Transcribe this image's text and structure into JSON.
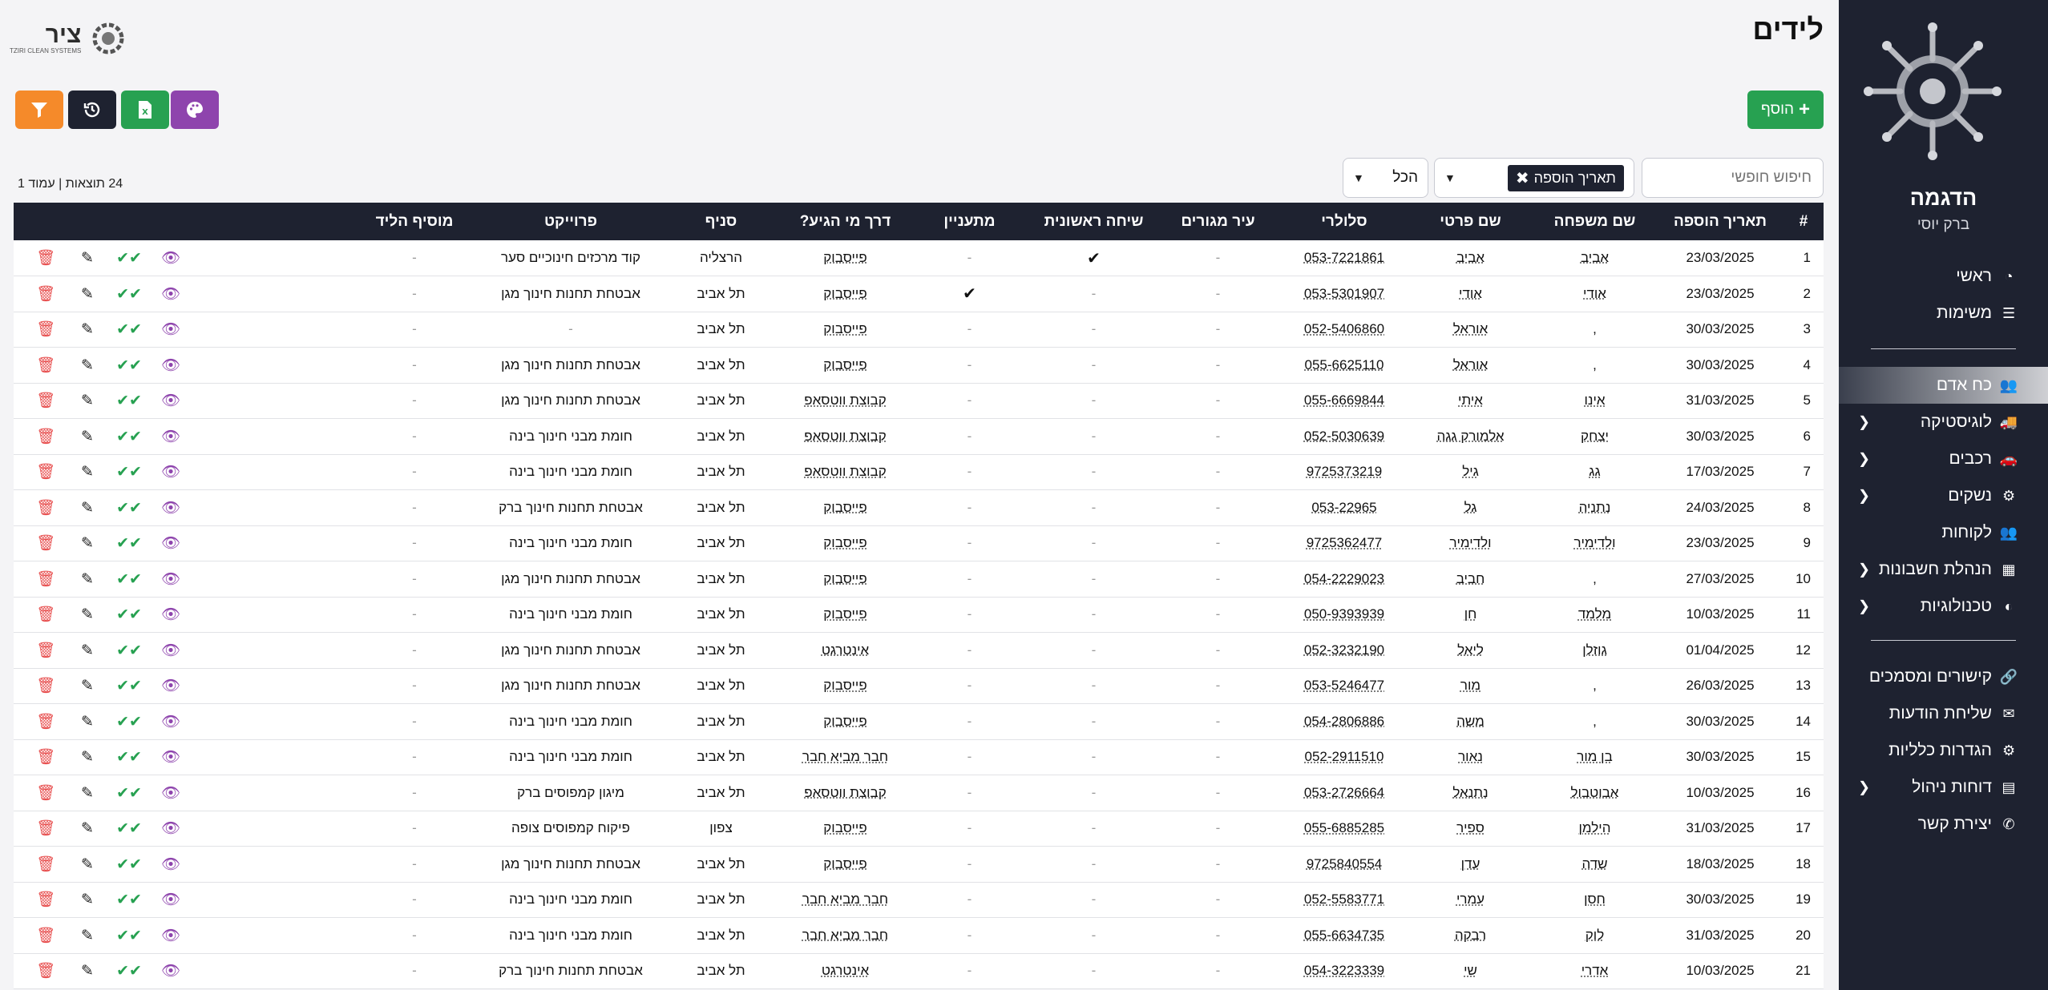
{
  "sidebar": {
    "company": "הדגמה",
    "user": "ברק יוסי",
    "nav_top": [
      {
        "label": "ראשי",
        "icon": "gauge-icon",
        "glyph": "◔"
      },
      {
        "label": "משימות",
        "icon": "tasks-icon",
        "glyph": "☰"
      }
    ],
    "nav_mid": [
      {
        "label": "כח אדם",
        "icon": "users-icon",
        "glyph": "👥",
        "active": true,
        "chevron": false
      },
      {
        "label": "לוגיסטיקה",
        "icon": "truck-icon",
        "glyph": "🚚",
        "chevron": true
      },
      {
        "label": "רכבים",
        "icon": "car-icon",
        "glyph": "🚗",
        "chevron": true
      },
      {
        "label": "נשקים",
        "icon": "gun-icon",
        "glyph": "⚙",
        "chevron": true
      },
      {
        "label": "לקוחות",
        "icon": "customers-icon",
        "glyph": "👥",
        "chevron": false
      },
      {
        "label": "הנהלת חשבונות",
        "icon": "ledger-icon",
        "glyph": "▦",
        "chevron": true
      },
      {
        "label": "טכנולוגיות",
        "icon": "tech-icon",
        "glyph": "◐",
        "chevron": true
      }
    ],
    "nav_bottom": [
      {
        "label": "קישורים ומסמכים",
        "icon": "link-icon",
        "glyph": "🔗",
        "chevron": false
      },
      {
        "label": "שליחת הודעות",
        "icon": "envelope-icon",
        "glyph": "✉",
        "chevron": false
      },
      {
        "label": "הגדרות כלליות",
        "icon": "settings-icon",
        "glyph": "⚙",
        "chevron": false
      },
      {
        "label": "דוחות ניהול",
        "icon": "reports-icon",
        "glyph": "▤",
        "chevron": true
      },
      {
        "label": "יצירת קשר",
        "icon": "phone-icon",
        "glyph": "✆",
        "chevron": false
      }
    ]
  },
  "header": {
    "title": "לידים",
    "brand_text": "ציר",
    "brand_sub": "TZIRI CLEAN SYSTEMS"
  },
  "toolbar": {
    "add_label": "הוסף",
    "search_placeholder": "חיפוש חופשי",
    "sort_tag": "תאריך הוספה",
    "filter_all": "הכל",
    "results": "24 תוצאות | עמוד 1"
  },
  "colors": {
    "sidebar_bg": "#1e2230",
    "add_green": "#27a151",
    "filter_orange": "#f58a2a",
    "palette_purple": "#8e44ad",
    "delete_red": "#e74c4c"
  },
  "table": {
    "headers": [
      "#",
      "תאריך הוספה",
      "שם משפחה",
      "שם פרטי",
      "סלולרי",
      "עיר מגורים",
      "שיחה ראשונית",
      "מתעניין",
      "דרך מי הגיע?",
      "סניף",
      "פרוייקט",
      "מוסיף הליד",
      ""
    ],
    "rows": [
      [
        "1",
        "23/03/2025",
        "אביב",
        "אביב",
        "053-7221861",
        "-",
        "✔",
        "-",
        "פייסבוק",
        "הרצליה",
        "קוד מרכזים חינוכיים סער",
        "-"
      ],
      [
        "2",
        "23/03/2025",
        "אודי",
        "אודי",
        "053-5301907",
        "-",
        "-",
        "✔",
        "פייסבוק",
        "תל אביב",
        "אבטחת תחנות חינוך מגן",
        "-"
      ],
      [
        "3",
        "30/03/2025",
        ",",
        "אוראל",
        "052-5406860",
        "-",
        "-",
        "-",
        "פייסבוק",
        "תל אביב",
        "-",
        "-"
      ],
      [
        "4",
        "30/03/2025",
        ",",
        "אוראל",
        "055-6625110",
        "-",
        "-",
        "-",
        "פייסבוק",
        "תל אביב",
        "אבטחת תחנות חינוך מגן",
        "-"
      ],
      [
        "5",
        "31/03/2025",
        "אינו",
        "איתי",
        "055-6669844",
        "-",
        "-",
        "-",
        "קבוצת ווטסאפ",
        "תל אביב",
        "אבטחת תחנות חינוך מגן",
        "-"
      ],
      [
        "6",
        "30/03/2025",
        "יצחק",
        "אלמורק גגה",
        "052-5030639",
        "-",
        "-",
        "-",
        "קבוצת ווטסאפ",
        "תל אביב",
        "חומת מבני חינוך בינה",
        "-"
      ],
      [
        "7",
        "17/03/2025",
        "גג",
        "גיל",
        "9725373219",
        "-",
        "-",
        "-",
        "קבוצת ווטסאפ",
        "תל אביב",
        "חומת מבני חינוך בינה",
        "-"
      ],
      [
        "8",
        "24/03/2025",
        "נתניה",
        "גל",
        "053-22965",
        "-",
        "-",
        "-",
        "פייסבוק",
        "תל אביב",
        "אבטחת תחנות חינוך ברק",
        "-"
      ],
      [
        "9",
        "23/03/2025",
        "ולדימיר",
        "ולדימיר",
        "9725362477",
        "-",
        "-",
        "-",
        "פייסבוק",
        "תל אביב",
        "חומת מבני חינוך בינה",
        "-"
      ],
      [
        "10",
        "27/03/2025",
        ",",
        "חביב",
        "054-2229023",
        "-",
        "-",
        "-",
        "פייסבוק",
        "תל אביב",
        "אבטחת תחנות חינוך מגן",
        "-"
      ],
      [
        "11",
        "10/03/2025",
        "מלמד",
        "חן",
        "050-9393939",
        "-",
        "-",
        "-",
        "פייסבוק",
        "תל אביב",
        "חומת מבני חינוך בינה",
        "-"
      ],
      [
        "12",
        "01/04/2025",
        "גוזלן",
        "ליאל",
        "052-3232190",
        "-",
        "-",
        "-",
        "אינטרגט",
        "תל אביב",
        "אבטחת תחנות חינוך מגן",
        "-"
      ],
      [
        "13",
        "26/03/2025",
        ",",
        "מור",
        "053-5246477",
        "-",
        "-",
        "-",
        "פייסבוק",
        "תל אביב",
        "אבטחת תחנות חינוך מגן",
        "-"
      ],
      [
        "14",
        "30/03/2025",
        ",",
        "משה",
        "054-2806886",
        "-",
        "-",
        "-",
        "פייסבוק",
        "תל אביב",
        "חומת מבני חינוך בינה",
        "-"
      ],
      [
        "15",
        "30/03/2025",
        "בן מור",
        "נאור",
        "052-2911510",
        "-",
        "-",
        "-",
        "חבר מביא חבר",
        "תל אביב",
        "חומת מבני חינוך בינה",
        "-"
      ],
      [
        "16",
        "10/03/2025",
        "אבוטבול",
        "נתנאל",
        "053-2726664",
        "-",
        "-",
        "-",
        "קבוצת ווטסאפ",
        "תל אביב",
        "מיגון קמפוסים ברק",
        "-"
      ],
      [
        "17",
        "31/03/2025",
        "הילמן",
        "ספיר",
        "055-6885285",
        "-",
        "-",
        "-",
        "פייסבוק",
        "צפון",
        "פיקוח קמפוסים צופה",
        "-"
      ],
      [
        "18",
        "18/03/2025",
        "שדה",
        "עדן",
        "9725840554",
        "-",
        "-",
        "-",
        "פייסבוק",
        "תל אביב",
        "אבטחת תחנות חינוך מגן",
        "-"
      ],
      [
        "19",
        "30/03/2025",
        "חסן",
        "עמרי",
        "052-5583771",
        "-",
        "-",
        "-",
        "חבר מביא חבר",
        "תל אביב",
        "חומת מבני חינוך בינה",
        "-"
      ],
      [
        "20",
        "31/03/2025",
        "לוק",
        "רבקה",
        "055-6634735",
        "-",
        "-",
        "-",
        "חבר מביא חבר",
        "תל אביב",
        "חומת מבני חינוך בינה",
        "-"
      ],
      [
        "21",
        "10/03/2025",
        "אדרי",
        "שי",
        "054-3223339",
        "-",
        "-",
        "-",
        "אינטרגט",
        "תל אביב",
        "אבטחת תחנות חינוך ברק",
        "-"
      ]
    ]
  }
}
